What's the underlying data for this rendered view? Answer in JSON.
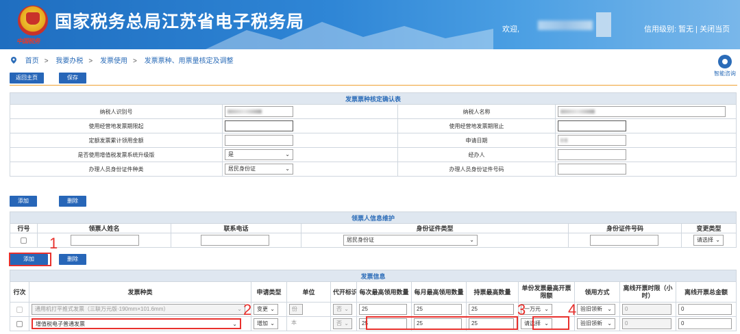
{
  "header": {
    "seal_text": "中国税务",
    "title": "国家税务总局江苏省电子税务局",
    "welcome": "欢迎,",
    "credit": "信用级别: 暂无 | 关闭当页"
  },
  "breadcrumb": [
    "首页",
    "我要办税",
    "发票使用",
    "发票票种、用票量核定及调整"
  ],
  "assistant": "智能咨询",
  "toolbar": {
    "back_label": "返回主页",
    "save_label": "保存"
  },
  "confirm": {
    "caption": "发票票种核定确认表",
    "rows": [
      {
        "l1": "纳税人识别号",
        "v1": "",
        "l2": "纳税人名称",
        "v2": ""
      },
      {
        "l1": "使用经营地发票期限起",
        "v1": "",
        "l2": "使用经营地发票期限止",
        "v2": ""
      },
      {
        "l1": "定额发票累计领用金额",
        "v1": "",
        "l2": "申请日期",
        "v2": ""
      },
      {
        "l1": "是否使用增值税发票系统升级版",
        "v1": "是",
        "l2": "经办人",
        "v2": ""
      },
      {
        "l1": "办理人员身份证件种类",
        "v1": "居民身份证",
        "l2": "办理人员身份证件号码",
        "v2": ""
      }
    ]
  },
  "taker_toolbar": {
    "add_label": "添加",
    "delete_label": "删除"
  },
  "taker": {
    "caption": "领票人信息维护",
    "columns": [
      "行号",
      "领票人姓名",
      "联系电话",
      "身份证件类型",
      "身份证件号码",
      "变更类型"
    ],
    "row": {
      "id_type": "居民身份证",
      "change_type": "请选择"
    }
  },
  "invoice_toolbar": {
    "add_label": "添加",
    "delete_label": "删除"
  },
  "invoice": {
    "caption": "发票信息",
    "columns": [
      "行次",
      "发票种类",
      "申请类型",
      "单位",
      "代开标识",
      "每次最高领用数量",
      "每月最高领用数量",
      "持票最高数量",
      "单份发票最高开票限额",
      "领用方式",
      "离线开票时限（小时）",
      "离线开票总金额"
    ],
    "rows": [
      {
        "kind": "通用机打平推式发票（三联万元版·190mm×101.6mm）",
        "apply": "变更",
        "unit": "份",
        "flag": "否",
        "per_time": "25",
        "per_month": "25",
        "hold": "25",
        "limit": "一万元",
        "method": "验旧领新",
        "offline_hours": "0",
        "offline_total": "0"
      },
      {
        "kind": "增值税电子普通发票",
        "apply": "增加",
        "unit": "本",
        "flag": "否",
        "per_time": "25",
        "per_month": "25",
        "hold": "25",
        "limit": "请选择",
        "method": "验旧领新",
        "offline_hours": "0",
        "offline_total": "0"
      }
    ]
  },
  "annotations": [
    "1",
    "2",
    "3",
    "4"
  ],
  "colors": {
    "header_blue": "#2f86d6",
    "button_blue": "#2766b8",
    "annotation_red": "#e8302c",
    "accent_orange": "#f0a030"
  }
}
